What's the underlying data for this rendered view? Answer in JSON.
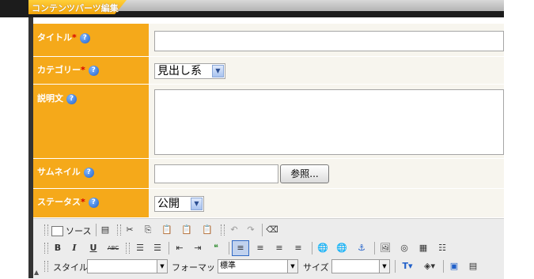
{
  "header": {
    "title": "コンテンツパーツ編集"
  },
  "form": {
    "title_label": "タイトル",
    "category_label": "カテゴリー",
    "category_value": "見出し系",
    "description_label": "説明文",
    "thumbnail_label": "サムネイル",
    "browse_button": "参照...",
    "status_label": "ステータス",
    "status_value": "公開",
    "required_mark": "*",
    "help_glyph": "?"
  },
  "editor": {
    "source_label": "ソース",
    "style_label": "スタイル",
    "format_label": "フォーマット",
    "format_value": "標準",
    "size_label": "サイズ",
    "bold": "B",
    "italic": "I",
    "underline": "U",
    "strike": "ABC",
    "scroll_arrow": "▲"
  },
  "colors": {
    "label_bg": "#f5a91a",
    "value_bg": "#f7f5ee",
    "header_dark": "#1c1c1c"
  }
}
